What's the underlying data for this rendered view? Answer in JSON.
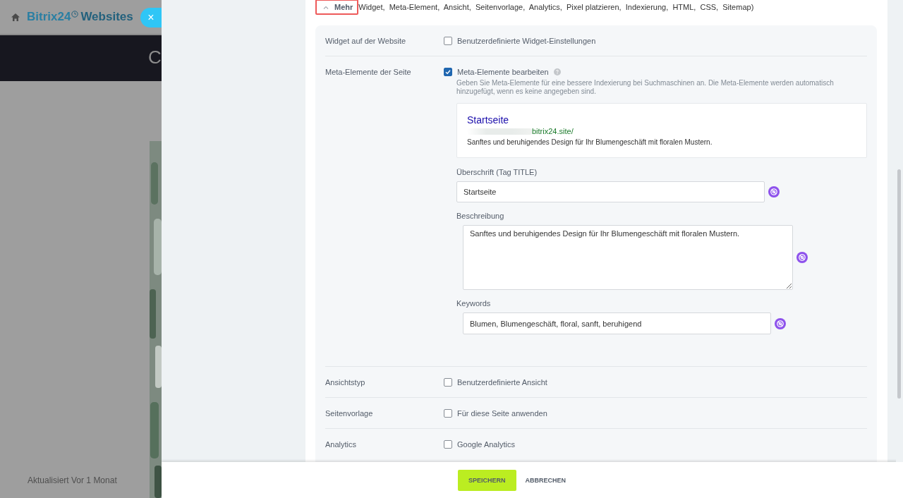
{
  "backdrop": {
    "brand": "Bitrix24",
    "product": "Websites",
    "banner_text": "C",
    "updated": "Aktualisiert Vor 1 Monat"
  },
  "close_button": "×",
  "more": {
    "label": "Mehr",
    "expanded": true,
    "highlighted": true,
    "summary": "Widget,  Meta-Element,  Ansicht,  Seitenvorlage,  Analytics,  Pixel platzieren,  Indexierung,  HTML,  CSS,  Sitemap)"
  },
  "rows": [
    {
      "kind": "checkbox",
      "label": "Widget auf der Website",
      "options": [
        {
          "label": "Benutzerdefinierte Widget-Einstellungen",
          "checked": false
        }
      ]
    },
    {
      "kind": "meta",
      "label": "Meta-Elemente der Seite",
      "option": {
        "label": "Meta-Elemente bearbeiten",
        "checked": true
      },
      "hint": "Geben Sie Meta-Elemente für eine bessere Indexierung bei Suchmaschinen an. Die Meta-Elemente werden automatisch hinzugefügt, wenn es keine angegeben sind.",
      "preview": {
        "title": "Startseite",
        "url": "bitrix24.site/",
        "description": "Sanftes und beruhigendes Design für Ihr Blumengeschäft mit floralen Mustern."
      },
      "fields": [
        {
          "kind": "input",
          "label": "Überschrift (Tag TITLE)",
          "value": "Startseite"
        },
        {
          "kind": "textarea",
          "label": "Beschreibung",
          "value": "Sanftes und beruhigendes Design für Ihr Blumengeschäft mit floralen Mustern."
        },
        {
          "kind": "input",
          "label": "Keywords",
          "value": "Blumen, Blumengeschäft, floral, sanft, beruhigend"
        }
      ]
    },
    {
      "kind": "checkbox",
      "label": "Ansichtstyp",
      "options": [
        {
          "label": "Benutzerdefinierte Ansicht",
          "checked": false
        }
      ]
    },
    {
      "kind": "checkbox",
      "label": "Seitenvorlage",
      "options": [
        {
          "label": "Für diese Seite anwenden",
          "checked": false
        }
      ]
    },
    {
      "kind": "checkbox",
      "label": "Analytics",
      "options": [
        {
          "label": "Google Analytics",
          "checked": false
        }
      ]
    }
  ],
  "footer": {
    "buttons": [
      {
        "kind": "primary",
        "label": "SPEICHERN"
      },
      {
        "kind": "link",
        "label": "ABBRECHEN"
      }
    ]
  }
}
